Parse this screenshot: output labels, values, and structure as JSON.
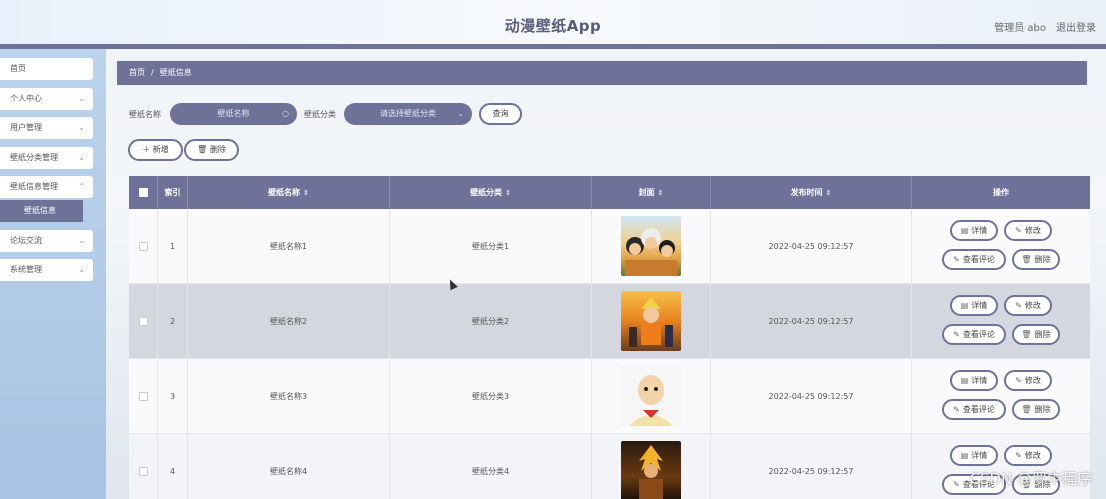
{
  "header": {
    "title": "动漫壁纸App",
    "user": "管理员 abo",
    "logout": "退出登录"
  },
  "sidebar": {
    "items": [
      {
        "label": "首页",
        "chevron": false
      },
      {
        "label": "个人中心",
        "chevron": true
      },
      {
        "label": "用户管理",
        "chevron": true
      },
      {
        "label": "壁纸分类管理",
        "chevron": true
      },
      {
        "label": "壁纸信息管理",
        "chevron": true
      },
      {
        "label": "论坛交流",
        "chevron": true
      },
      {
        "label": "系统管理",
        "chevron": true
      }
    ],
    "active_sub": "壁纸信息"
  },
  "breadcrumb": {
    "home": "首页",
    "sep": "/",
    "current": "壁纸信息"
  },
  "search": {
    "name_label": "壁纸名称",
    "name_placeholder": "壁纸名称",
    "category_label": "壁纸分类",
    "category_placeholder": "请选择壁纸分类",
    "query_button": "查询"
  },
  "toolbar": {
    "add_button": "新增",
    "delete_button": "删除"
  },
  "table": {
    "headers": {
      "index": "索引",
      "name": "壁纸名称",
      "category": "壁纸分类",
      "cover": "封面",
      "time": "发布时间",
      "actions": "操作"
    },
    "rows": [
      {
        "index": "1",
        "name": "壁纸名称1",
        "category": "壁纸分类1",
        "time": "2022-04-25 09:12:57"
      },
      {
        "index": "2",
        "name": "壁纸名称2",
        "category": "壁纸分类2",
        "time": "2022-04-25 09:12:57"
      },
      {
        "index": "3",
        "name": "壁纸名称3",
        "category": "壁纸分类3",
        "time": "2022-04-25 09:12:57"
      },
      {
        "index": "4",
        "name": "壁纸名称4",
        "category": "壁纸分类4",
        "time": "2022-04-25 09:12:57"
      }
    ],
    "actions": {
      "detail": "详情",
      "edit": "修改",
      "comments": "查看评论",
      "delete": "删除"
    }
  },
  "watermark": "CSDN @罗中程序",
  "colors": {
    "accent": "#6e7299",
    "sidebar": "#b3cbe8"
  }
}
